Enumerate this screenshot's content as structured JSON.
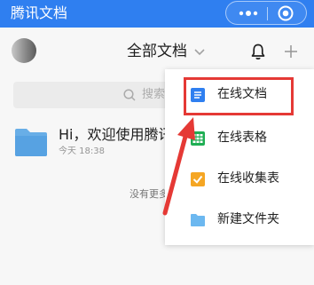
{
  "topbar": {
    "title": "腾讯文档",
    "accent": "#2f7ff0",
    "more_icon": "more-dots-icon",
    "close_icon": "target-close-icon"
  },
  "header": {
    "title": "全部文档",
    "caret_icon": "chevron-down-icon",
    "bell_icon": "bell-icon",
    "plus_icon": "plus-icon"
  },
  "search": {
    "placeholder": "搜索",
    "icon": "search-icon"
  },
  "list": {
    "items": [
      {
        "title": "Hi，欢迎使用腾讯",
        "meta": "今天 18:38",
        "icon": "folder-icon"
      }
    ],
    "footer": "没有更多"
  },
  "menu": {
    "items": [
      {
        "label": "在线文档",
        "icon": "doc-icon",
        "color": "#2f7ff0"
      },
      {
        "label": "在线表格",
        "icon": "sheet-icon",
        "color": "#1fae53"
      },
      {
        "label": "在线收集表",
        "icon": "form-icon",
        "color": "#f5a623"
      },
      {
        "label": "新建文件夹",
        "icon": "folder-icon",
        "color": "#6cb8f0"
      }
    ],
    "highlight_color": "#e53935"
  }
}
